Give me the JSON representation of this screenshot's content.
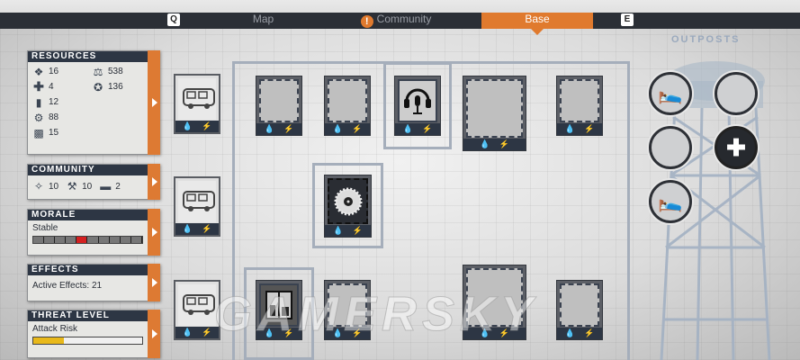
{
  "topbar": {
    "key_left": "Q",
    "key_right": "E",
    "tabs": [
      {
        "label": "Map"
      },
      {
        "label": "Community"
      },
      {
        "label": "Base"
      }
    ],
    "active_tab": "Base"
  },
  "panels": {
    "resources": {
      "title": "RESOURCES",
      "items": [
        {
          "icon": "food-icon",
          "value": "16"
        },
        {
          "icon": "materials-icon",
          "value": "538"
        },
        {
          "icon": "medicine-icon",
          "value": "4"
        },
        {
          "icon": "influence-icon",
          "value": "136"
        },
        {
          "icon": "ammo-icon",
          "value": "12"
        },
        {
          "icon": "",
          "value": ""
        },
        {
          "icon": "parts-icon",
          "value": "88"
        },
        {
          "icon": "",
          "value": ""
        },
        {
          "icon": "fuel-icon",
          "value": "15"
        }
      ]
    },
    "community": {
      "title": "COMMUNITY",
      "survivors": "10",
      "workers": "10",
      "beds": "2"
    },
    "morale": {
      "title": "MORALE",
      "label": "Stable",
      "level_fraction": 0.5
    },
    "effects": {
      "title": "EFFECTS",
      "label": "Active Effects: 21"
    },
    "threat": {
      "title": "THREAT LEVEL",
      "label": "Attack Risk",
      "level_fraction": 0.28
    }
  },
  "outposts": {
    "title": "OUTPOSTS",
    "slots": [
      {
        "icon": "bed-icon"
      },
      {
        "icon": ""
      },
      {
        "icon": ""
      },
      {
        "icon": "medical-cross-icon"
      },
      {
        "icon": "bed-icon"
      }
    ]
  },
  "watermark": "GAMERSKY",
  "colors": {
    "accent": "#e07a2e",
    "panel_header": "#2d3644",
    "frame": "#a5aebb",
    "morale_marker": "#d42020",
    "threat_fill": "#e8b81a"
  }
}
